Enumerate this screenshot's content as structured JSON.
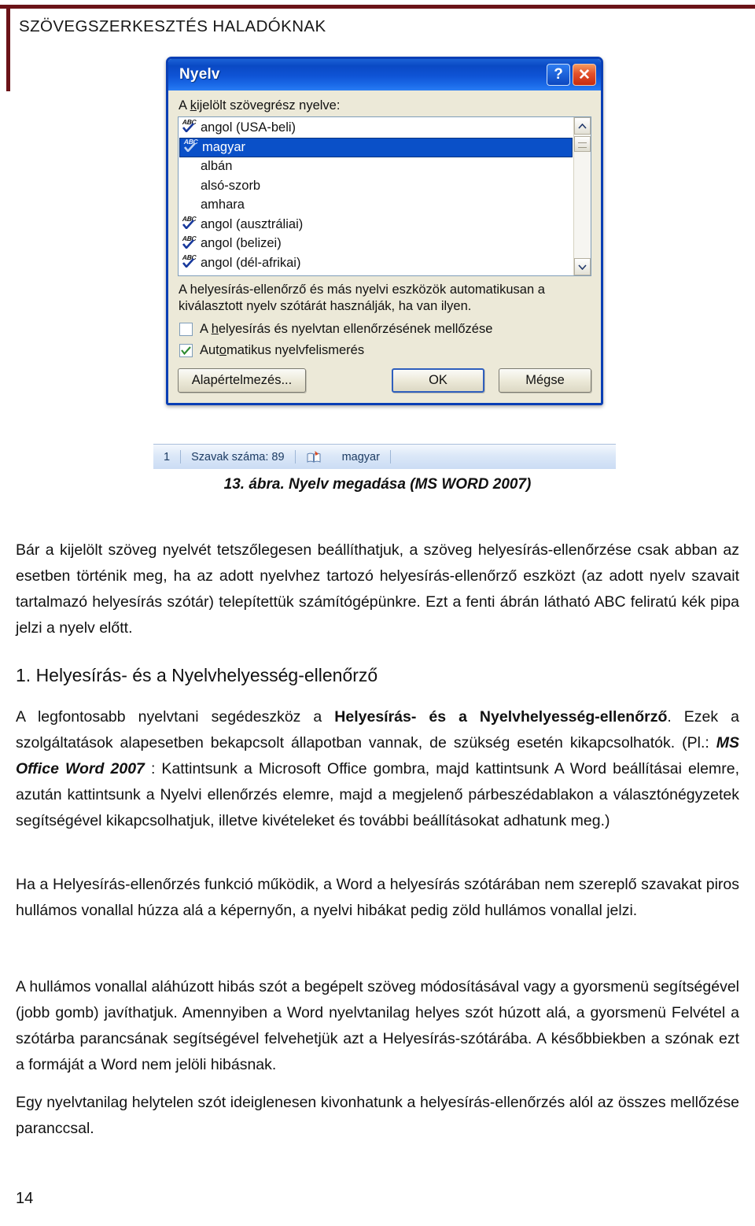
{
  "document": {
    "running_header": "SZÖVEGSZERKESZTÉS HALADÓKNAK",
    "page_number": "14",
    "accent_color": "#6b1318"
  },
  "figure": {
    "caption": "13. ábra. Nyelv megadása (MS WORD 2007)",
    "dialog": {
      "title": "Nyelv",
      "help_button": "?",
      "close_button": "✕",
      "field_label": "A kijelölt szövegrész nyelve:",
      "list": {
        "items": [
          {
            "label": "angol (USA-beli)",
            "has_abc_icon": true,
            "selected": false
          },
          {
            "label": "magyar",
            "has_abc_icon": true,
            "selected": true
          },
          {
            "label": "albán",
            "has_abc_icon": false,
            "selected": false
          },
          {
            "label": "alsó-szorb",
            "has_abc_icon": false,
            "selected": false
          },
          {
            "label": "amhara",
            "has_abc_icon": false,
            "selected": false
          },
          {
            "label": "angol (ausztráliai)",
            "has_abc_icon": true,
            "selected": false
          },
          {
            "label": "angol (belizei)",
            "has_abc_icon": true,
            "selected": false
          },
          {
            "label": "angol (dél-afrikai)",
            "has_abc_icon": true,
            "selected": false
          }
        ],
        "icon_name": "abc-spellcheck-icon",
        "selection_color": "#0a50c8"
      },
      "hint_line_1": "A helyesírás-ellenőrző és más nyelvi eszközök automatikusan a",
      "hint_line_2": "kiválasztott nyelv szótárát használják, ha van ilyen.",
      "checkboxes": [
        {
          "label": "A helyesírás és nyelvtan ellenőrzésének mellőzése",
          "checked": false
        },
        {
          "label": "Automatikus nyelvfelismerés",
          "checked": true
        }
      ],
      "buttons": {
        "defaults": "Alapértelmezés...",
        "ok": "OK",
        "cancel": "Mégse"
      }
    },
    "statusbar": {
      "page": "1",
      "word_count": "Szavak száma: 89",
      "proofing_icon": "proofing-book-icon",
      "language": "magyar"
    }
  },
  "body": {
    "paragraph_1": "Bár a kijelölt szöveg nyelvét tetszőlegesen beállíthatjuk, a szöveg helyesírás-ellenőrzése csak abban az esetben történik meg, ha az adott nyelvhez tartozó helyesírás-ellenőrző eszközt (az adott nyelv szavait tartalmazó helyesírás szótár) telepítettük számítógépünkre. Ezt a fenti ábrán látható ABC feliratú kék pipa jelzi a nyelv előtt.",
    "heading_1": "1. Helyesírás- és a Nyelvhelyesség-ellenőrző",
    "paragraph_2_part1": "A legfontosabb nyelvtani segédeszköz a ",
    "paragraph_2_bold": "Helyesírás- és a Nyelvhelyesség-ellenőrző",
    "paragraph_2_part2": ". Ezek a szolgáltatások alapesetben bekapcsolt állapotban vannak, de szükség esetén kikapcsolhatók. (Pl.: ",
    "paragraph_2_italic": "MS Office Word 2007 ",
    "paragraph_2_part3": ": Kattintsunk a Microsoft Office gombra, majd kattintsunk A Word beállításai elemre, azután kattintsunk a Nyelvi ellenőrzés elemre, majd a megjelenő párbeszédablakon a választónégyzetek segítségével kikapcsolhatjuk, illetve kivételeket és további beállításokat adhatunk meg.)",
    "paragraph_3": "Ha a Helyesírás-ellenőrzés funkció működik, a Word a helyesírás szótárában nem szereplő szavakat piros hullámos vonallal húzza alá a képernyőn, a nyelvi hibákat pedig zöld hullámos vonallal jelzi.",
    "paragraph_4": "A hullámos vonallal aláhúzott hibás szót a begépelt szöveg módosításával vagy a gyorsmenü segítségével (jobb gomb) javíthatjuk. Amennyiben a Word nyelvtanilag helyes szót húzott alá, a gyorsmenü Felvétel a szótárba parancsának segítségével felvehetjük azt a Helyesírás-szótárába. A későbbiekben a szónak ezt a formáját a Word nem jelöli hibásnak.",
    "paragraph_5": "Egy nyelvtanilag helytelen szót ideiglenesen kivonhatunk a helyesírás-ellenőrzés alól az összes mellőzése paranccsal."
  }
}
